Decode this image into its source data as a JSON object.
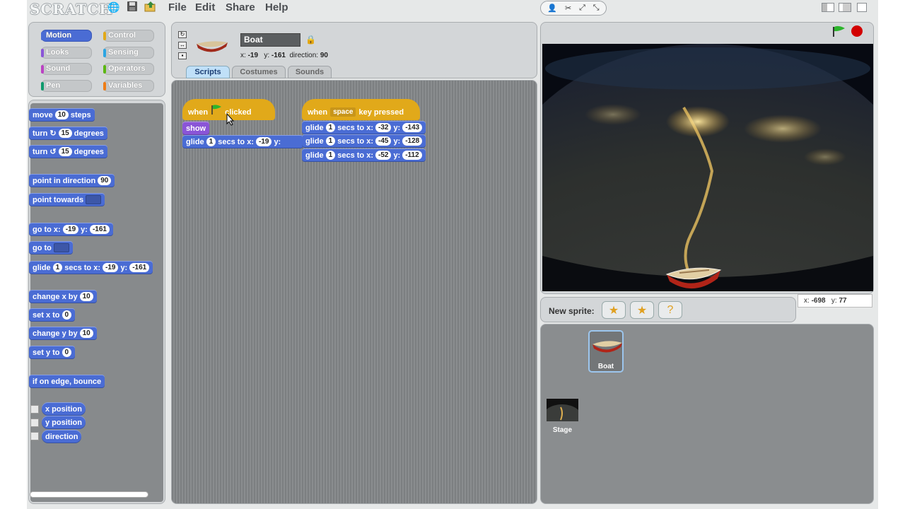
{
  "app": {
    "logo": "SCRATCH"
  },
  "toolbar": {
    "icons": [
      "globe-icon",
      "save-icon",
      "share-icon"
    ],
    "modes": [
      "person-icon",
      "wand-icon",
      "grow-icon",
      "shrink-icon"
    ]
  },
  "menu": [
    "File",
    "Edit",
    "Share",
    "Help"
  ],
  "categories": [
    {
      "label": "Motion",
      "color": "#4a6cd4"
    },
    {
      "label": "Control",
      "color": "#e1a91a"
    },
    {
      "label": "Looks",
      "color": "#8a55d7"
    },
    {
      "label": "Sensing",
      "color": "#2ca5e2"
    },
    {
      "label": "Sound",
      "color": "#bb42c3"
    },
    {
      "label": "Operators",
      "color": "#5cb712"
    },
    {
      "label": "Pen",
      "color": "#0e9a6c"
    },
    {
      "label": "Variables",
      "color": "#ee7d16"
    }
  ],
  "palette": {
    "move": {
      "a": "move",
      "n": "10",
      "b": "steps"
    },
    "turn_cw": {
      "a": "turn",
      "n": "15",
      "b": "degrees"
    },
    "turn_ccw": {
      "a": "turn",
      "n": "15",
      "b": "degrees"
    },
    "point_dir": {
      "a": "point in direction",
      "n": "90"
    },
    "point_towards": {
      "a": "point towards"
    },
    "goto_xy": {
      "a": "go to x:",
      "x": "-19",
      "b": "y:",
      "y": "-161"
    },
    "goto": {
      "a": "go to"
    },
    "glide": {
      "a": "glide",
      "n": "1",
      "b": "secs to x:",
      "x": "-19",
      "c": "y:",
      "y": "-161"
    },
    "change_x": {
      "a": "change x by",
      "n": "10"
    },
    "set_x": {
      "a": "set x to",
      "n": "0"
    },
    "change_y": {
      "a": "change y by",
      "n": "10"
    },
    "set_y": {
      "a": "set y to",
      "n": "0"
    },
    "bounce": {
      "a": "if on edge, bounce"
    },
    "reporters": [
      "x position",
      "y position",
      "direction"
    ]
  },
  "sprite": {
    "name": "Boat",
    "x_label": "x:",
    "x": "-19",
    "y_label": "y:",
    "y": "-161",
    "dir_label": "direction:",
    "dir": "90"
  },
  "tabs": [
    "Scripts",
    "Costumes",
    "Sounds"
  ],
  "scripts": {
    "flag_hat": {
      "a": "when",
      "b": "clicked"
    },
    "show": "show",
    "glide1": {
      "a": "glide",
      "n": "1",
      "b": "secs to x:",
      "x": "-19",
      "c": "y:"
    },
    "key_hat": {
      "a": "when",
      "key": "space",
      "b": "key pressed"
    },
    "glides": [
      {
        "a": "glide",
        "n": "1",
        "b": "secs to x:",
        "x": "-32",
        "c": "y:",
        "y": "-143"
      },
      {
        "a": "glide",
        "n": "1",
        "b": "secs to x:",
        "x": "-45",
        "c": "y:",
        "y": "-128"
      },
      {
        "a": "glide",
        "n": "1",
        "b": "secs to x:",
        "x": "-52",
        "c": "y:",
        "y": "-112"
      }
    ]
  },
  "stage": {
    "mouse_x_label": "x:",
    "mouse_x": "-698",
    "mouse_y_label": "y:",
    "mouse_y": "77"
  },
  "new_sprite_label": "New sprite:",
  "sprites_list": [
    {
      "name": "Boat"
    }
  ],
  "stage_thumb": {
    "name": "Stage"
  },
  "colors": {
    "motion": "#4a6cd4",
    "looks": "#8a55d7",
    "control": "#e1a91a",
    "stop": "#d20000",
    "flag": "#2cb52c"
  }
}
